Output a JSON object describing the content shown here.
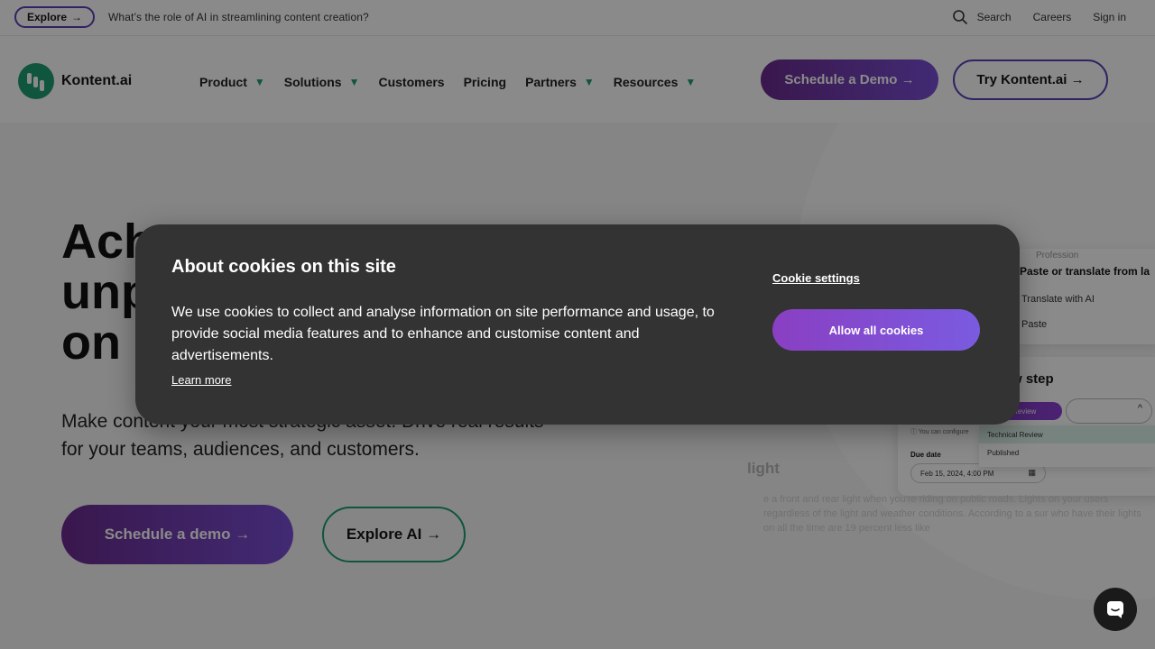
{
  "topbar": {
    "explore_label": "Explore",
    "explore_arrow": "→",
    "announcement": "What’s the role of AI in streamlining content creation?",
    "search_label": "Search",
    "links": [
      "Careers",
      "Sign in"
    ]
  },
  "nav": {
    "logo_text": "Kontent.ai",
    "items": [
      {
        "label": "Product",
        "chevron": "▼"
      },
      {
        "label": "Solutions",
        "chevron": "▼"
      },
      {
        "label": "Customers"
      },
      {
        "label": "Pricing"
      },
      {
        "label": "Partners",
        "chevron": "▼"
      },
      {
        "label": "Resources",
        "chevron": "▼"
      }
    ],
    "demo_button": "Schedule a Demo →",
    "try_button": "Try Kontent.ai →"
  },
  "hero": {
    "title_line1": "Ach",
    "title_line2": "unp",
    "title_line3": "on",
    "subtitle": "Make content your most strategic asset. Drive real results for your teams, audiences, and customers.",
    "demo_button": "Schedule a demo →",
    "explore_button": "Explore AI →"
  },
  "mock": {
    "card1_tag": "Profession",
    "card1_title": "Paste or translate from la",
    "card1_row1": "Translate with AI",
    "card1_row2": "Paste",
    "card2_step": "w step",
    "card2_tag": "al Review",
    "card2_caret": "^",
    "card2_info": "ⓘ You can configure",
    "card2_due_label": "Due date",
    "card2_due_value": "Feb 15, 2024, 4:00 PM",
    "card2_cal_icon": "▦",
    "dropdown_option1": "Technical Review",
    "dropdown_option2": "Published",
    "light_heading": "light",
    "light_paragraph": "e a front and rear light when you're riding on public roads. Lights on your users regardless of the light and weather conditions. According to a sur who have their lights on all the time are 19 percent less like"
  },
  "cookie": {
    "title": "About cookies on this site",
    "text": "We use cookies to collect and analyse information on site performance and usage, to provide social media features and to enhance and customise content and advertisements.",
    "learn_more": "Learn more",
    "settings": "Cookie settings",
    "allow_all": "Allow all cookies"
  },
  "colors": {
    "brand_purple": "#6b2c8f",
    "brand_violet": "#7a4fd6",
    "brand_green": "#1f9e74",
    "dialog_bg": "#333333"
  },
  "icons": {
    "search": "search-icon",
    "chevron": "chevron-down-icon",
    "chat": "chat-icon",
    "logo": "kontent-logo-icon"
  }
}
